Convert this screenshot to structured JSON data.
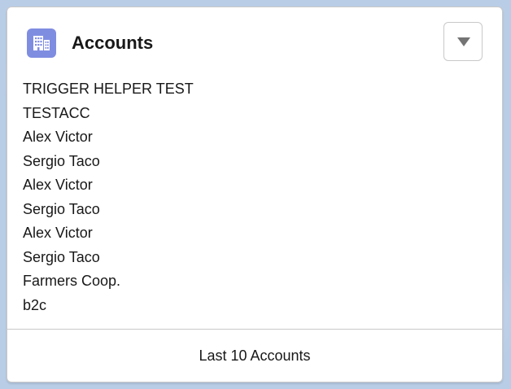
{
  "card": {
    "title": "Accounts",
    "icon": "account-building-icon",
    "icon_color": "#7f8de1",
    "menu_icon": "chevron-down-icon"
  },
  "records": [
    "TRIGGER HELPER TEST",
    "TESTACC",
    "Alex Victor",
    "Sergio Taco",
    "Alex Victor",
    "Sergio Taco",
    "Alex Victor",
    "Sergio Taco",
    "Farmers Coop.",
    "b2c"
  ],
  "footer": {
    "label": "Last 10 Accounts"
  }
}
